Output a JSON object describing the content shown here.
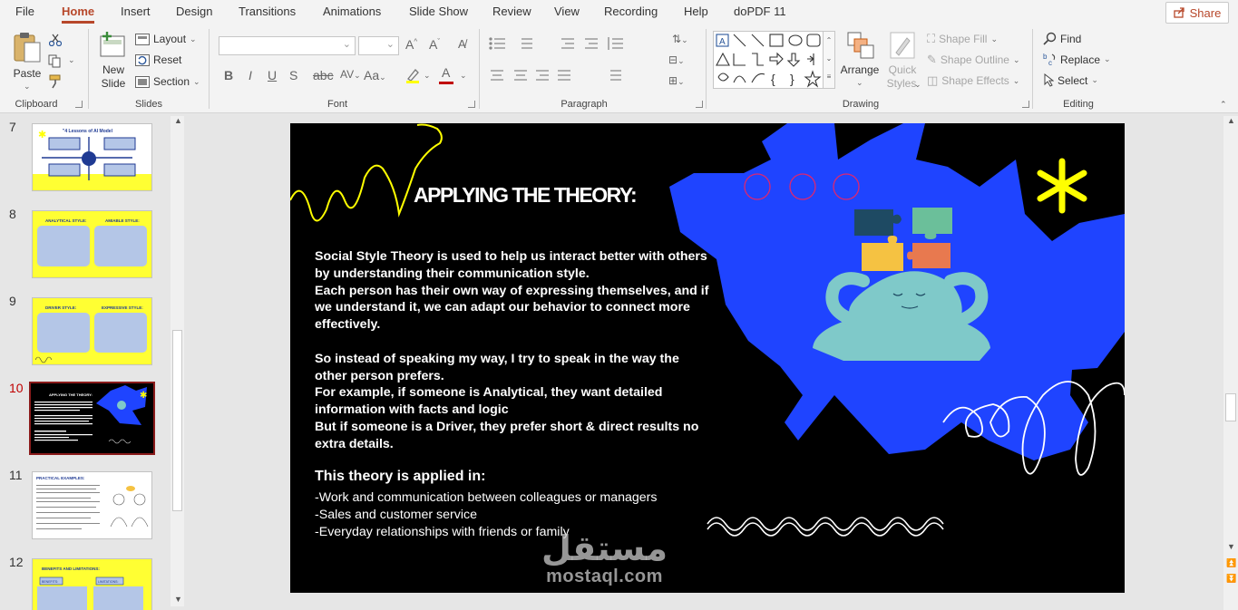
{
  "menu": {
    "tabs": [
      "File",
      "Home",
      "Insert",
      "Design",
      "Transitions",
      "Animations",
      "Slide Show",
      "Review",
      "View",
      "Recording",
      "Help",
      "doPDF 11"
    ],
    "active": "Home",
    "share_label": "Share"
  },
  "ribbon": {
    "clipboard": {
      "label": "Clipboard",
      "paste": "Paste"
    },
    "slides": {
      "label": "Slides",
      "new_slide_line1": "New",
      "new_slide_line2": "Slide",
      "layout": "Layout",
      "reset": "Reset",
      "section": "Section"
    },
    "font": {
      "label": "Font",
      "bold": "B",
      "italic": "I",
      "underline": "U",
      "strike": "S"
    },
    "paragraph": {
      "label": "Paragraph"
    },
    "drawing": {
      "label": "Drawing",
      "arrange": "Arrange",
      "quick_styles_line1": "Quick",
      "quick_styles_line2": "Styles",
      "shape_fill": "Shape Fill",
      "shape_outline": "Shape Outline",
      "shape_effects": "Shape Effects"
    },
    "editing": {
      "label": "Editing",
      "find": "Find",
      "replace": "Replace",
      "select": "Select"
    }
  },
  "thumbnails": {
    "numbers": [
      "7",
      "8",
      "9",
      "10",
      "11",
      "12"
    ],
    "current": "10",
    "slide7_title": "\"4 Lessons of AI Model",
    "slide8_left": "ANALYTICAL STYLE:",
    "slide8_right": "AMIABLE STYLE:",
    "slide9_left": "DRIVER STYLE:",
    "slide9_right": "EXPRESSIVE STYLE:",
    "slide10_title": "APPLYING THE THEORY:",
    "slide11_title": "PRACTICAL EXAMPLES:",
    "slide12_title": "BENEFITS AND LIMITATIONS:",
    "slide12_left": "BENEFITS:",
    "slide12_right": "LIMITATIONS:"
  },
  "slide": {
    "title": "APPLYING THE THEORY:",
    "para1": "Social Style Theory is used to help us interact better with others by understanding their communication style.\nEach person has their own way of expressing themselves, and if we understand it, we can adapt our behavior to connect more effectively.",
    "para2": "So instead of speaking my way, I try to speak in the way the other person prefers.\nFor example, if someone is Analytical, they want detailed information with facts and logic\nBut if someone is a Driver, they prefer short & direct results no extra details.",
    "applied_title": "This theory is applied in:",
    "applied_items": [
      "-Work and communication between colleagues or managers",
      "-Sales and customer service",
      "-Everyday relationships  with friends or family"
    ],
    "colors": {
      "blob": "#1f44ff",
      "yellow": "#ffff00",
      "figure": "#7fc9c9",
      "circles": "#e0266e"
    }
  },
  "watermark": {
    "arabic": "مستقل",
    "latin": "mostaql.com"
  }
}
